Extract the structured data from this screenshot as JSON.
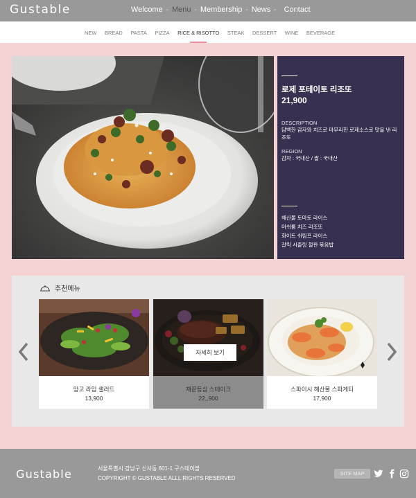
{
  "brand": {
    "logo_text": "Gustable"
  },
  "main_nav": {
    "items": [
      "Welcome",
      "Menu",
      "Membership",
      "News",
      "Contact"
    ],
    "separators": [
      "-",
      "-",
      "-",
      "-"
    ],
    "active": "Menu"
  },
  "sub_nav": {
    "items": [
      "NEW",
      "BREAD",
      "PASTA",
      "PIZZA",
      "RICE & RISOTTO",
      "STEAK",
      "DESSERT",
      "WINE",
      "BEVERAGE"
    ],
    "active": "RICE & RISOTTO"
  },
  "featured": {
    "name": "로제 포테이토 리조또",
    "price": "21,900",
    "description_label": "DESCRIPTION",
    "description": "담백한 감자와 치즈로 마무리한 로제소스로 맛을 낸 리조또",
    "region_label": "REGION",
    "region": "감자 : 국내산 / 쌀 : 국내산",
    "related": [
      "해산물 토마토 라이스",
      "머쉬룸 치즈 리조또",
      "화이트 쉬림프 라이스",
      "갈릭 시즐링 철판 볶음밥"
    ]
  },
  "recommended": {
    "title": "추천메뉴",
    "detail_button": "자세히 보기",
    "cards": [
      {
        "name": "망고 라임 샐러드",
        "price": "13,900"
      },
      {
        "name": "채끝등심 스테이크",
        "price": "22,,900"
      },
      {
        "name": "스파이시 해산물 스파게티",
        "price": "17,900"
      }
    ]
  },
  "footer": {
    "logo_text": "Gustable",
    "address": "서울특별시 강남구 신사동 601-1  구스테이블",
    "copyright": "COPYRIGHT © GUSTABLE ALLL RIGHTS RESERVED",
    "sitemap_label": "SITE MAP",
    "social": [
      "twitter-icon",
      "facebook-icon",
      "instagram-icon"
    ]
  },
  "colors": {
    "page_bg": "#f2d2d3",
    "header_bg": "#999999",
    "panel_bg": "#373050",
    "accent": "#ee8d9b"
  }
}
